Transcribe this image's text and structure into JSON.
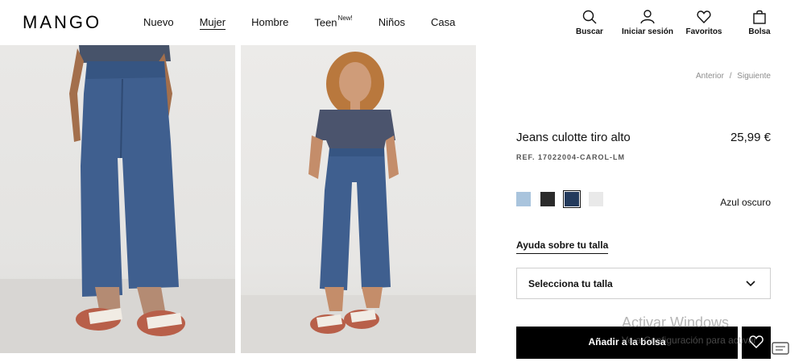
{
  "header": {
    "logo": "MANGO",
    "nav": [
      {
        "label": "Nuevo",
        "active": false,
        "sup": ""
      },
      {
        "label": "Mujer",
        "active": true,
        "sup": ""
      },
      {
        "label": "Hombre",
        "active": false,
        "sup": ""
      },
      {
        "label": "Teen",
        "active": false,
        "sup": "New!"
      },
      {
        "label": "Niños",
        "active": false,
        "sup": ""
      },
      {
        "label": "Casa",
        "active": false,
        "sup": ""
      }
    ],
    "tools": {
      "search": {
        "label": "Buscar",
        "icon": "search-icon"
      },
      "login": {
        "label": "Iniciar sesión",
        "icon": "user-icon"
      },
      "favorites": {
        "label": "Favoritos",
        "icon": "heart-icon"
      },
      "bag": {
        "label": "Bolsa",
        "icon": "bag-icon"
      }
    }
  },
  "pager": {
    "prev": "Anterior",
    "sep": "/",
    "next": "Siguiente"
  },
  "product": {
    "title": "Jeans culotte tiro alto",
    "price": "25,99 €",
    "ref": "REF. 17022004-CAROL-LM",
    "selected_color": "Azul oscuro",
    "colors": [
      "#a9c4dd",
      "#2b2b2b",
      "#233a5c",
      "#e9e9e9"
    ],
    "help_link": "Ayuda sobre tu talla",
    "size_placeholder": "Selecciona tu talla",
    "add_to_bag": "Añadir a la bolsa"
  },
  "watermark": {
    "line1": "Activar Windows",
    "line2": "Ve a Configuración para activar"
  }
}
